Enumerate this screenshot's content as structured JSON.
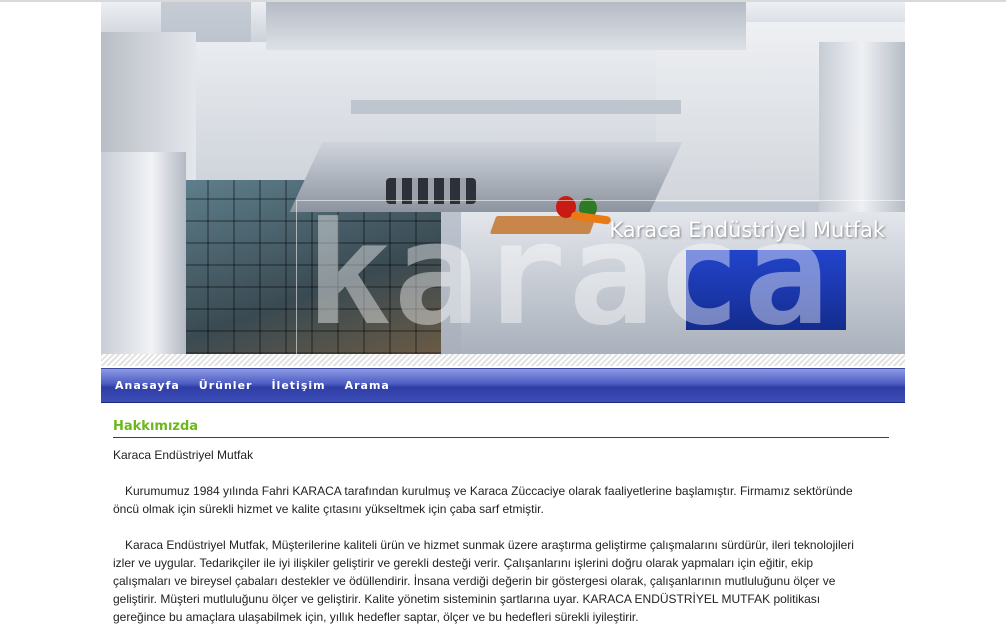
{
  "header": {
    "company_title": "Karaca Endüstriyel Mutfak",
    "banner_word": "karaca"
  },
  "nav": {
    "items": [
      {
        "label": "Anasayfa"
      },
      {
        "label": "Ürünler"
      },
      {
        "label": "İletişim"
      },
      {
        "label": "Arama"
      }
    ]
  },
  "content": {
    "section_title": "Hakkımızda",
    "paragraphs": [
      "Karaca Endüstriyel Mutfak",
      "Kurumumuz 1984 yılında Fahri KARACA tarafından kurulmuş ve Karaca Züccaciye olarak faaliyetlerine başlamıştır. Firmamız sektöründe öncü olmak için sürekli hizmet ve kalite çıtasını yükseltmek için çaba sarf etmiştir.",
      "Karaca Endüstriyel Mutfak, Müşterilerine kaliteli ürün ve hizmet sunmak üzere araştırma geliştirme çalışmalarını sürdürür, ileri teknolojileri izler ve uygular. Tedarikçiler ile iyi ilişkiler geliştirir ve gerekli desteği verir. Çalışanlarını işlerini doğru olarak yapmaları için eğitir, ekip çalışmaları ve bireysel çabaları destekler ve ödüllendirir. İnsana verdiği değerin bir göstergesi olarak, çalışanlarının mutluluğunu ölçer ve geliştirir. Müşteri mutluluğunu ölçer ve geliştirir. Kalite yönetim sisteminin şartlarına uyar. KARACA ENDÜSTRİYEL MUTFAK politikası gereğince bu amaçlara ulaşabilmek için, yıllık hedefler saptar, ölçer ve bu hedefleri sürekli iyileştirir."
    ]
  },
  "colors": {
    "nav_blue": "#3c4db9",
    "title_green": "#6cb81c",
    "rule_blue": "#2c3b86"
  }
}
